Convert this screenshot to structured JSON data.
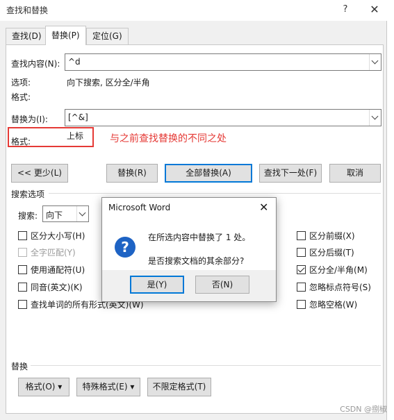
{
  "window": {
    "title": "查找和替换",
    "help": "?",
    "close": "✕"
  },
  "tabs": [
    {
      "label": "查找(D)"
    },
    {
      "label": "替换(P)"
    },
    {
      "label": "定位(G)"
    }
  ],
  "find": {
    "label": "查找内容(N):",
    "value": "^d"
  },
  "options": {
    "label": "选项:",
    "value": "向下搜索, 区分全/半角"
  },
  "format1": {
    "label": "格式:"
  },
  "replace": {
    "label": "替换为(I):",
    "value": "[^&]"
  },
  "format2": {
    "label": "格式:",
    "value": "上标"
  },
  "annotation": "与之前查找替换的不同之处",
  "buttons": {
    "less": "<< 更少(L)",
    "replace": "替换(R)",
    "replace_all": "全部替换(A)",
    "find_next": "查找下一处(F)",
    "cancel": "取消"
  },
  "search_options": {
    "header": "搜索选项",
    "search_label": "搜索:",
    "search_value": "向下",
    "left": [
      {
        "label": "区分大小写(H)",
        "checked": false,
        "disabled": false
      },
      {
        "label": "全字匹配(Y)",
        "checked": false,
        "disabled": true
      },
      {
        "label": "使用通配符(U)",
        "checked": false,
        "disabled": false
      },
      {
        "label": "同音(英文)(K)",
        "checked": false,
        "disabled": false
      },
      {
        "label": "查找单词的所有形式(英文)(W)",
        "checked": false,
        "disabled": false
      }
    ],
    "right": [
      {
        "label": "区分前缀(X)",
        "checked": false
      },
      {
        "label": "区分后缀(T)",
        "checked": false
      },
      {
        "label": "区分全/半角(M)",
        "checked": true
      },
      {
        "label": "忽略标点符号(S)",
        "checked": false
      },
      {
        "label": "忽略空格(W)",
        "checked": false
      }
    ]
  },
  "replace_section": {
    "header": "替换",
    "format_button": "格式(O) ▾",
    "special_button": "特殊格式(E) ▾",
    "no_format_button": "不限定格式(T)"
  },
  "message_box": {
    "title": "Microsoft Word",
    "line1": "在所选内容中替换了 1 处。",
    "line2": "是否搜索文档的其余部分?",
    "yes": "是(Y)",
    "no": "否(N)",
    "close": "✕"
  },
  "watermark": "CSDN @捌椒"
}
